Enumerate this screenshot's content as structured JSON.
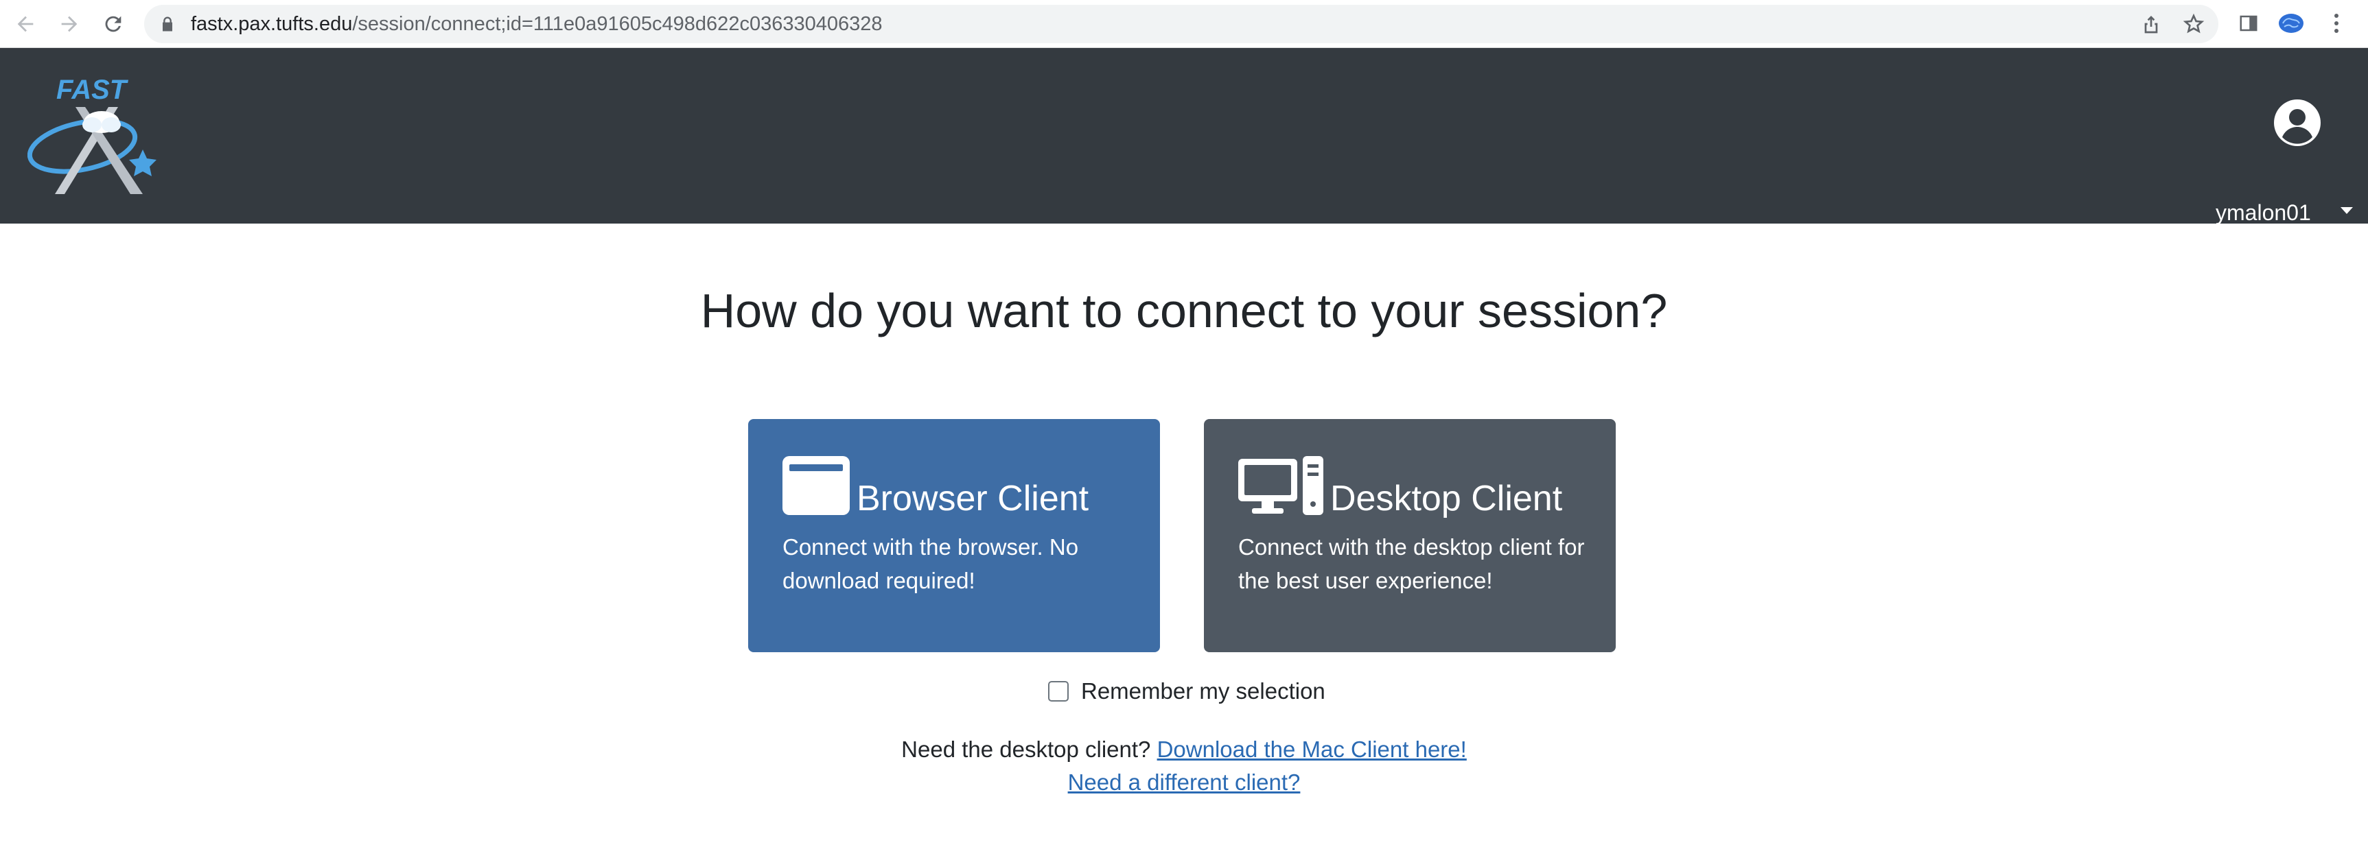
{
  "browser": {
    "url_host": "fastx.pax.tufts.edu",
    "url_path": "/session/connect;id=111e0a91605c498d622c036330406328"
  },
  "header": {
    "logo_text": "FAST",
    "username": "ymalon01"
  },
  "main": {
    "title": "How do you want to connect to your session?",
    "cards": [
      {
        "title": "Browser Client",
        "description": "Connect with the browser. No download required!",
        "color": "#3e6da5",
        "icon": "browser-window-icon"
      },
      {
        "title": "Desktop Client",
        "description": "Connect with the desktop client for the best user experience!",
        "color": "#4f5862",
        "icon": "desktop-computer-icon"
      }
    ],
    "remember_label": "Remember my selection",
    "help_prefix": "Need the desktop client?",
    "download_link": "Download the Mac Client here!",
    "different_client_link": "Need a different client?"
  },
  "colors": {
    "header_bg": "#343a40",
    "link": "#2a6ab3"
  }
}
